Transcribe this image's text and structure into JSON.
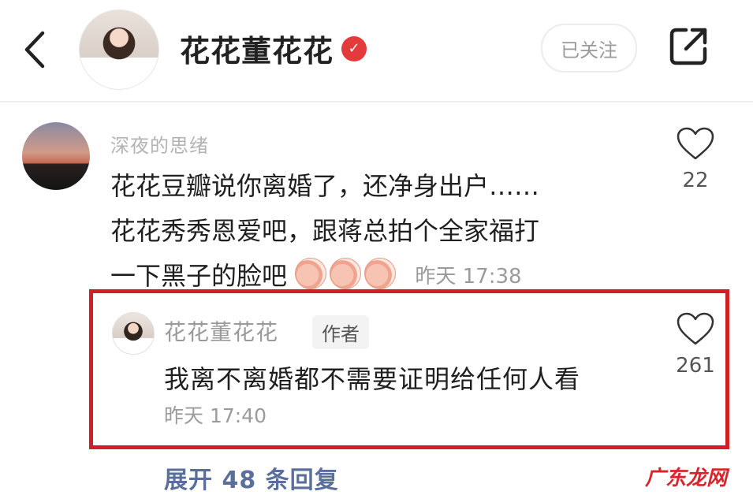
{
  "header": {
    "title": "花花董花花",
    "follow_label": "已关注"
  },
  "comment": {
    "username": "深夜的思绪",
    "text_line1": "花花豆瓣说你离婚了，还净身出户……",
    "text_line2": "花花秀秀恩爱吧，跟蒋总拍个全家福打",
    "text_line3": "一下黑子的脸吧",
    "time": "昨天 17:38",
    "likes": "22"
  },
  "reply": {
    "username": "花花董花花",
    "badge": "作者",
    "text": "我离不离婚都不需要证明给任何人看",
    "time": "昨天 17:40",
    "likes": "261"
  },
  "expand_replies": "展开 48 条回复",
  "watermark": "广东龙网",
  "colors": {
    "highlight_border": "#d21f24",
    "verified_badge": "#e33b3b",
    "link_blue": "#5a6f9a"
  },
  "icons": [
    "back-arrow-icon",
    "verified-check-icon",
    "share-icon",
    "heart-icon",
    "pig-face-emoji-icon"
  ]
}
